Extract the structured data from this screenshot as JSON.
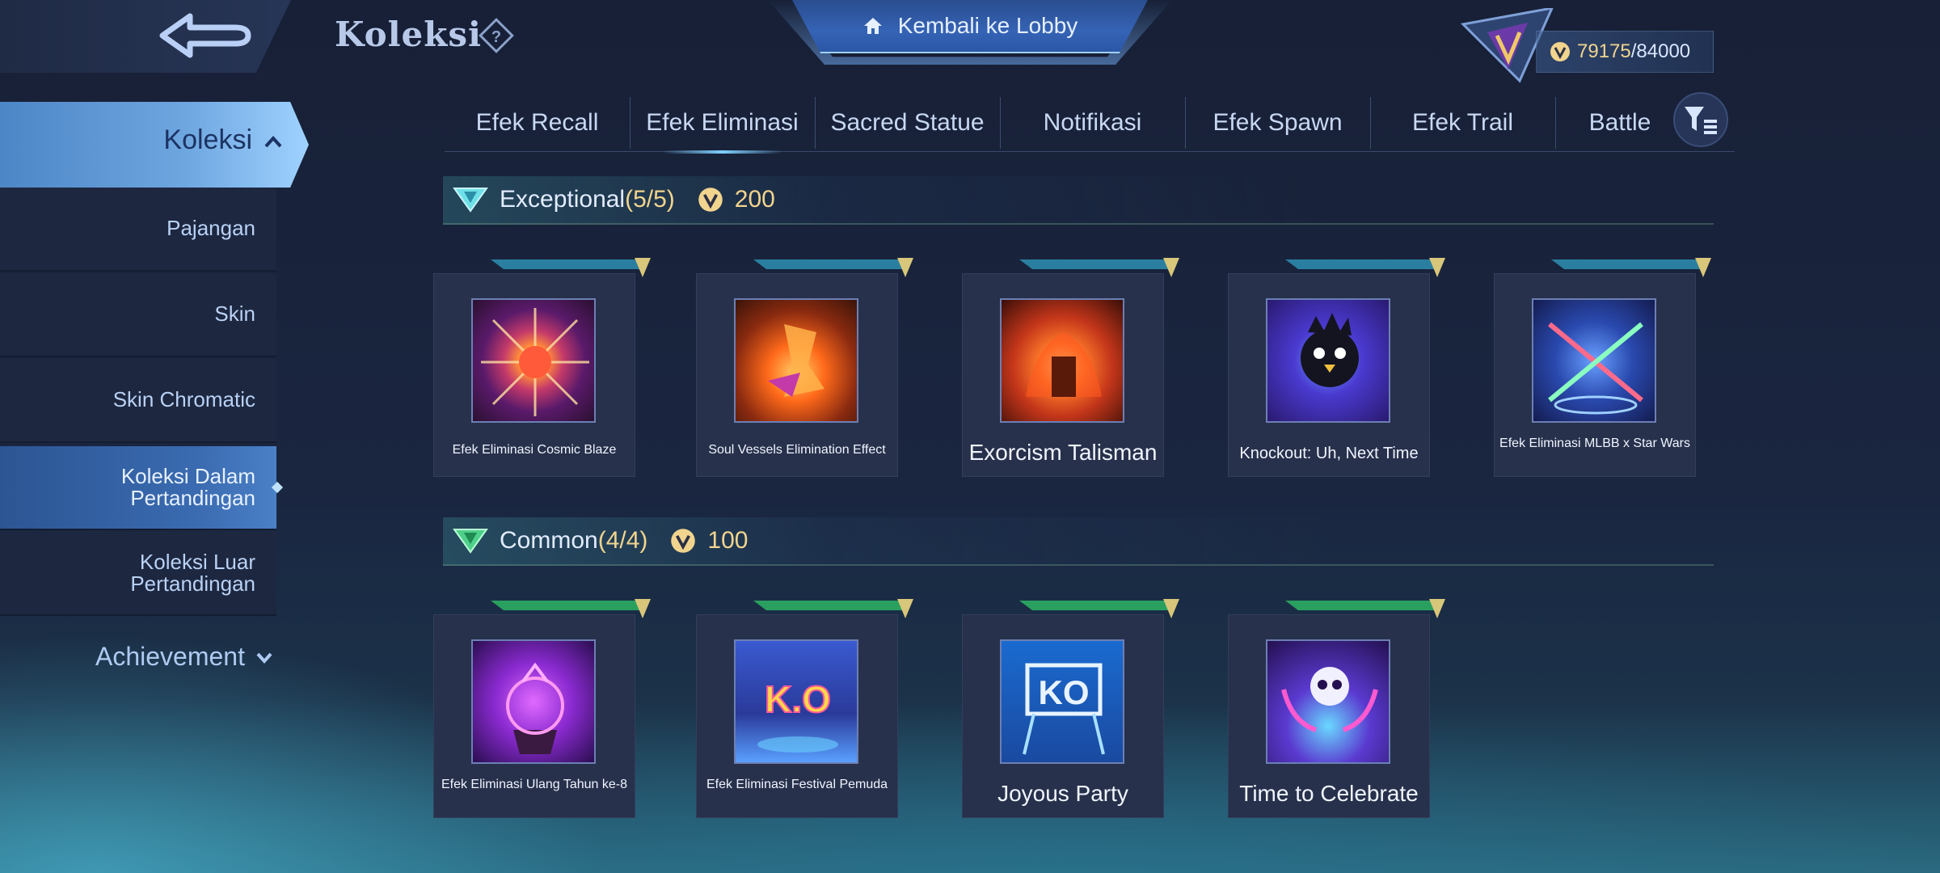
{
  "header": {
    "title": "Koleksi",
    "lobby_label": "Kembali ke Lobby",
    "currency_current": "79175",
    "currency_max": "/84000"
  },
  "sidebar": {
    "main_label": "Koleksi",
    "items": [
      {
        "label": "Pajangan"
      },
      {
        "label": "Skin"
      },
      {
        "label": "Skin Chromatic"
      },
      {
        "label": "Koleksi Dalam Pertandingan"
      },
      {
        "label": "Koleksi Luar Pertandingan"
      }
    ],
    "achievement_label": "Achievement"
  },
  "tabs": [
    "Efek Recall",
    "Efek Eliminasi",
    "Sacred Statue",
    "Notifikasi",
    "Efek Spawn",
    "Efek Trail",
    "Battle"
  ],
  "sections": {
    "exceptional": {
      "name": "Exceptional",
      "count": "(5/5)",
      "points": "200",
      "items": [
        {
          "label": "Efek Eliminasi Cosmic Blaze"
        },
        {
          "label": "Soul Vessels Elimination Effect"
        },
        {
          "label": "Exorcism Talisman"
        },
        {
          "label": "Knockout: Uh, Next Time"
        },
        {
          "label": "Efek Eliminasi MLBB x Star Wars"
        }
      ]
    },
    "common": {
      "name": "Common",
      "count": "(4/4)",
      "points": "100",
      "items": [
        {
          "label": "Efek Eliminasi Ulang Tahun ke-8"
        },
        {
          "label": "Efek Eliminasi Festival Pemuda"
        },
        {
          "label": "Joyous Party"
        },
        {
          "label": "Time to Celebrate"
        }
      ]
    }
  },
  "ko_text": "KO",
  "ko_text2": "K.O"
}
